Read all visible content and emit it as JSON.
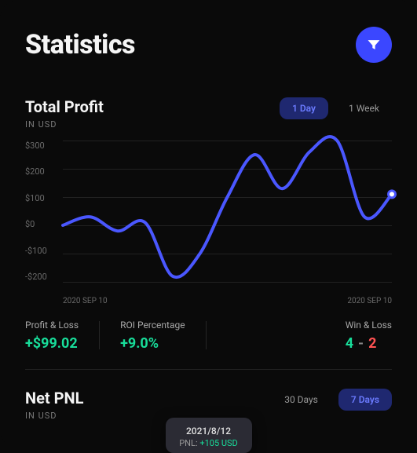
{
  "header": {
    "title": "Statistics",
    "filter_icon": "filter"
  },
  "total_profit": {
    "title": "Total Profit",
    "subtitle": "IN USD",
    "tabs": [
      {
        "label": "1 Day",
        "active": true
      },
      {
        "label": "1 Week",
        "active": false
      }
    ],
    "x_labels": [
      "2020 SEP 10",
      "2020 SEP 10"
    ]
  },
  "stats": {
    "pl_label": "Profit & Loss",
    "pl_value": "+$99.02",
    "roi_label": "ROI Percentage",
    "roi_value": "+9.0%",
    "wl_label": "Win & Loss",
    "wl_win": "4",
    "wl_dash": "-",
    "wl_loss": "2"
  },
  "net_pnl": {
    "title": "Net PNL",
    "subtitle": "IN USD",
    "tabs": [
      {
        "label": "30 Days",
        "active": false
      },
      {
        "label": "7 Days",
        "active": true
      }
    ],
    "tooltip_date": "2021/8/12",
    "tooltip_label": "PNL:",
    "tooltip_value": "+105 USD"
  },
  "chart_data": {
    "type": "line",
    "title": "Total Profit",
    "xlabel": "",
    "ylabel": "USD",
    "ylim": [
      -200,
      300
    ],
    "y_ticks": [
      "$300",
      "$200",
      "$100",
      "$0",
      "-$100",
      "-$200"
    ],
    "x_range": [
      "2020 SEP 10",
      "2020 SEP 10"
    ],
    "series": [
      {
        "name": "Profit",
        "color": "#4a57ff",
        "x": [
          0,
          1,
          2,
          3,
          4,
          5,
          6,
          7,
          8,
          9,
          10,
          11,
          12
        ],
        "values": [
          0,
          30,
          -20,
          10,
          -180,
          -100,
          100,
          250,
          130,
          260,
          300,
          30,
          110
        ]
      }
    ],
    "marker": {
      "x": 12,
      "y": 110
    }
  }
}
